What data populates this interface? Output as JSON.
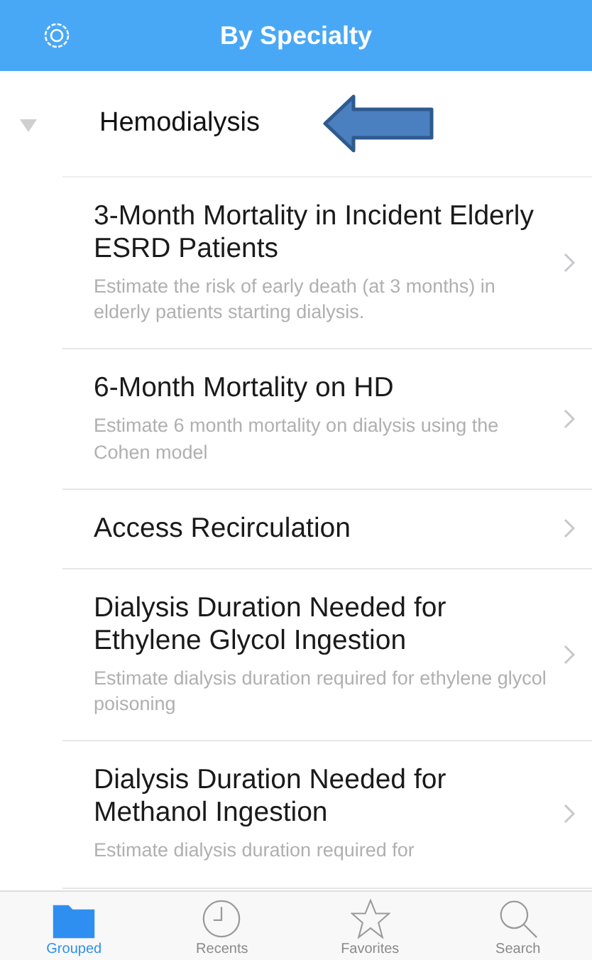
{
  "nav_bar": {
    "title": "By Specialty"
  },
  "section": {
    "title": "Hemodialysis",
    "expanded": true
  },
  "items": [
    {
      "title": "3-Month Mortality in Incident Elderly ESRD Patients",
      "description": "Estimate the risk of early death (at 3 months) in elderly patients starting dialysis."
    },
    {
      "title": "6-Month Mortality on HD",
      "description": "Estimate 6 month mortality on dialysis using the Cohen model"
    },
    {
      "title": "Access Recirculation"
    },
    {
      "title": "Dialysis Duration Needed for Ethylene Glycol Ingestion",
      "description": "Estimate dialysis duration required for ethylene glycol poisoning"
    },
    {
      "title": "Dialysis Duration Needed for Methanol Ingestion",
      "description": "Estimate dialysis duration required for"
    }
  ],
  "tab_bar": [
    {
      "kind": "folder",
      "label": "Grouped",
      "selected": true
    },
    {
      "kind": "clock",
      "label": "Recents",
      "selected": false
    },
    {
      "kind": "star",
      "label": "Favorites",
      "selected": false
    },
    {
      "kind": "search",
      "label": "Search",
      "selected": false
    }
  ]
}
